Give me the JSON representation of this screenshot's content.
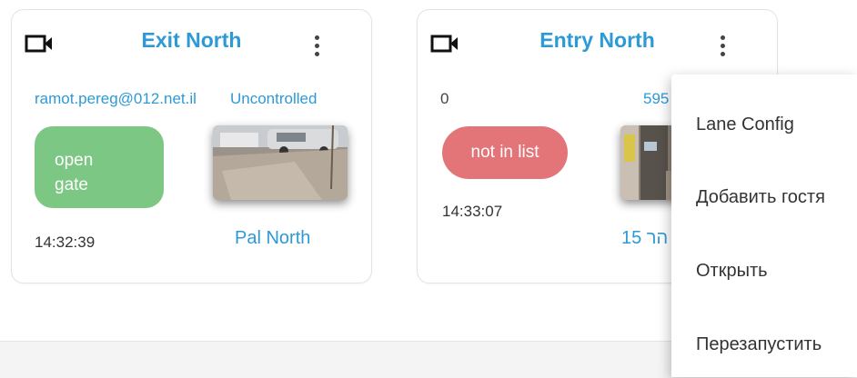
{
  "cards": [
    {
      "title": "Exit North",
      "email": "ramot.pereg@012.net.il",
      "mode": "Uncontrolled",
      "status_line1": "open",
      "status_line2": "gate",
      "time": "14:32:39",
      "lane_name": "Pal North",
      "status_color": "#7cc783"
    },
    {
      "title": "Entry North",
      "count": "0",
      "plate_partial": "595",
      "status": "not in list",
      "time": "14:33:07",
      "lane_name": "הר 15",
      "status_color": "#e37578"
    }
  ],
  "context_menu": {
    "items": [
      "Lane Config",
      "Добавить гостя",
      "Открыть",
      "Перезапустить"
    ]
  },
  "colors": {
    "accent": "#2d9ad6",
    "green": "#7cc783",
    "red": "#e37578"
  },
  "icons": {
    "camera": "video-camera-icon",
    "menu": "more-vertical-icon"
  }
}
